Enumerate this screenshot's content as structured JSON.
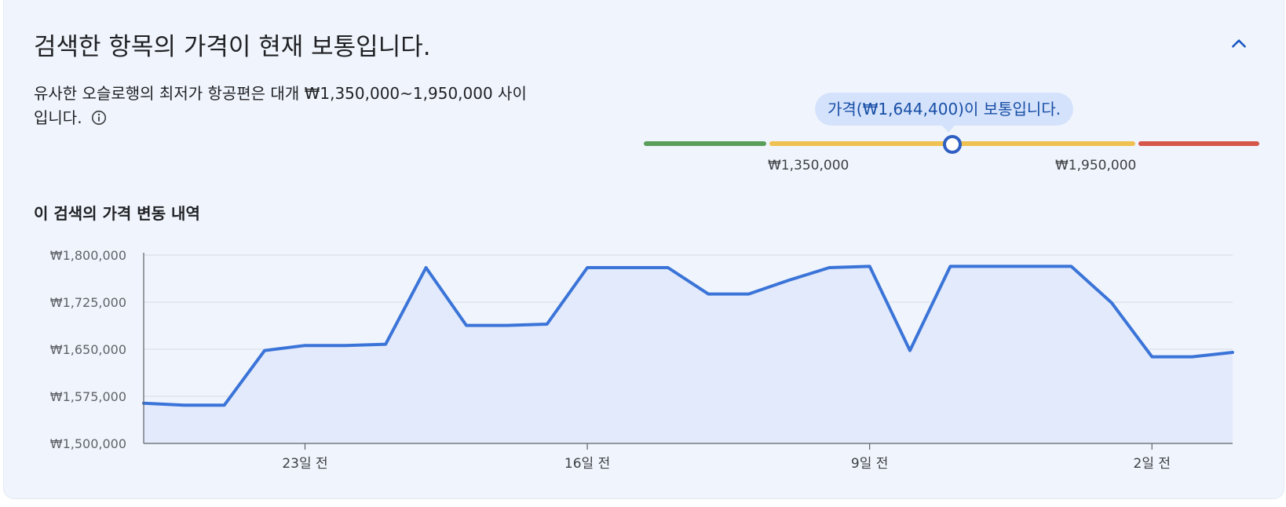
{
  "header": {
    "title": "검색한 항목의 가격이 현재 보통입니다.",
    "collapse_icon": "chevron-up-icon"
  },
  "summary": {
    "text": "유사한 오슬로행의 최저가 항공편은 대개 ₩1,350,000~1,950,000 사이입니다.",
    "info_icon": "info-icon"
  },
  "gauge": {
    "bubble": "가격(₩1,644,400)이 보통입니다.",
    "current_price": 1644400,
    "low_threshold": 1350000,
    "high_threshold": 1950000,
    "low_label": "₩1,350,000",
    "high_label": "₩1,950,000",
    "colors": {
      "low": "#5a9e5c",
      "typical": "#efc150",
      "high": "#d6574a",
      "marker": "#2f5fc2"
    }
  },
  "history": {
    "title": "이 검색의 가격 변동 내역"
  },
  "chart_data": {
    "type": "area",
    "title": "",
    "xlabel": "",
    "ylabel": "",
    "ylim": [
      1500000,
      1800000
    ],
    "yticks": [
      1500000,
      1575000,
      1650000,
      1725000,
      1800000
    ],
    "ytick_labels": [
      "₩1,500,000",
      "₩1,575,000",
      "₩1,650,000",
      "₩1,725,000",
      "₩1,800,000"
    ],
    "xlim": [
      -27,
      0
    ],
    "xticks": [
      -23,
      -16,
      -9,
      -2
    ],
    "xtick_labels": [
      "23일 전",
      "16일 전",
      "9일 전",
      "2일 전"
    ],
    "grid": true,
    "line_color": "#3b74d8",
    "fill_color": "#e2eafb",
    "series": [
      {
        "x": [
          -27,
          -26,
          -25,
          -24,
          -23,
          -22,
          -21,
          -20,
          -19,
          -18,
          -17,
          -16,
          -15,
          -14,
          -13,
          -12,
          -11,
          -10,
          -9,
          -8,
          -7,
          -6,
          -5,
          -4,
          -3,
          -2,
          -1,
          0
        ],
        "values": [
          1564000,
          1561000,
          1561000,
          1648000,
          1656000,
          1656000,
          1658000,
          1780000,
          1688000,
          1688000,
          1690000,
          1780000,
          1780000,
          1780000,
          1738000,
          1738000,
          1760000,
          1780000,
          1782000,
          1648000,
          1782000,
          1782000,
          1782000,
          1782000,
          1724000,
          1638000,
          1638000,
          1645000
        ]
      }
    ]
  }
}
